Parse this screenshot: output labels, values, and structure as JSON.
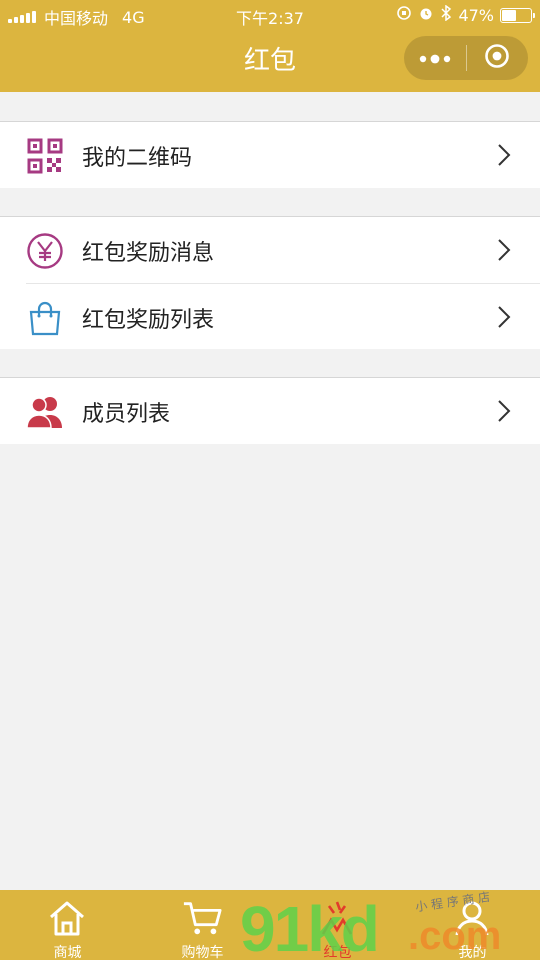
{
  "status_bar": {
    "carrier": "中国移动",
    "network": "4G",
    "time": "下午2:37",
    "battery": "47%",
    "battery_level": 0.47
  },
  "nav": {
    "title": "红包",
    "capsule_icons": [
      "more-icon",
      "close-mini-program-icon"
    ]
  },
  "sections": [
    {
      "items": [
        {
          "label": "我的二维码",
          "icon": "qrcode-icon"
        }
      ]
    },
    {
      "items": [
        {
          "label": "红包奖励消息",
          "icon": "yen-icon"
        },
        {
          "label": "红包奖励列表",
          "icon": "shopping-bag-icon"
        }
      ]
    },
    {
      "items": [
        {
          "label": "成员列表",
          "icon": "members-icon"
        }
      ]
    }
  ],
  "tabbar": [
    {
      "label": "商城",
      "icon": "home-icon",
      "active": false
    },
    {
      "label": "购物车",
      "icon": "cart-icon",
      "active": false
    },
    {
      "label": "红包",
      "icon": "redpacket-icon",
      "active": true
    },
    {
      "label": "我的",
      "icon": "user-icon",
      "active": false
    }
  ],
  "watermark": {
    "text": "91kd",
    "domain": ".com",
    "slogan": "小 程 序 商 店"
  },
  "colors": {
    "brand": "#dcb53f",
    "qrcode_icon": "#a63a82",
    "yen_icon": "#a63a82",
    "bag_icon": "#3a8fc7",
    "members_icon": "#c83a4a",
    "active_tab": "#e23b2b"
  }
}
